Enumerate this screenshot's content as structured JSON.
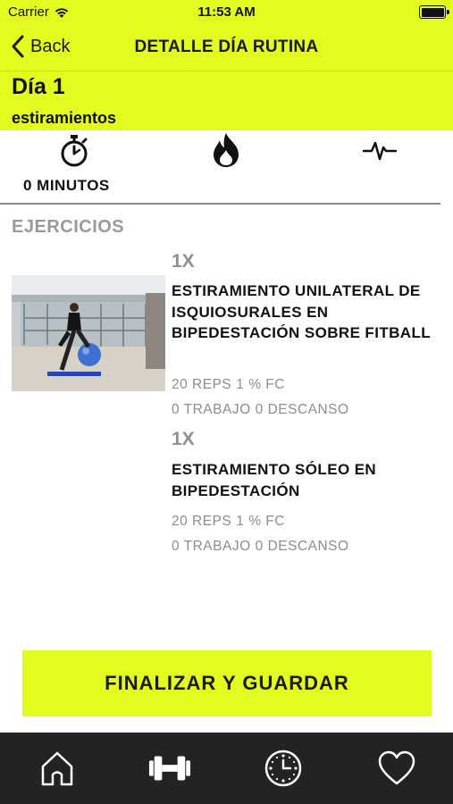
{
  "status_bar": {
    "carrier": "Carrier",
    "time": "11:53 AM"
  },
  "nav": {
    "back_label": "Back",
    "title": "DETALLE DÍA RUTINA"
  },
  "day": {
    "title": "Día 1",
    "subtitle": "estiramientos"
  },
  "stats": {
    "minutes_label": "0 MINUTOS"
  },
  "section": {
    "title": "EJERCICIOS"
  },
  "exercises": [
    {
      "sets": "1X",
      "name": "ESTIRAMIENTO UNILATERAL DE ISQUIOSURALES EN BIPEDESTACIÓN SOBRE FITBALL",
      "reps": "20 REPS",
      "fc": "1 % FC",
      "work": "0 TRABAJO",
      "rest": "0 DESCANSO"
    },
    {
      "sets": "1X",
      "name": "ESTIRAMIENTO SÓLEO EN BIPEDESTACIÓN",
      "reps": "20 REPS",
      "fc": "1 % FC",
      "work": "0 TRABAJO",
      "rest": "0 DESCANSO"
    }
  ],
  "actions": {
    "finish_label": "FINALIZAR Y GUARDAR"
  },
  "tabs": [
    "home-icon",
    "dumbbell-icon",
    "clock-icon",
    "heart-icon"
  ],
  "colors": {
    "accent": "#e4fb1f",
    "tab_bar": "#232323",
    "muted_text": "#8d8d8d"
  }
}
